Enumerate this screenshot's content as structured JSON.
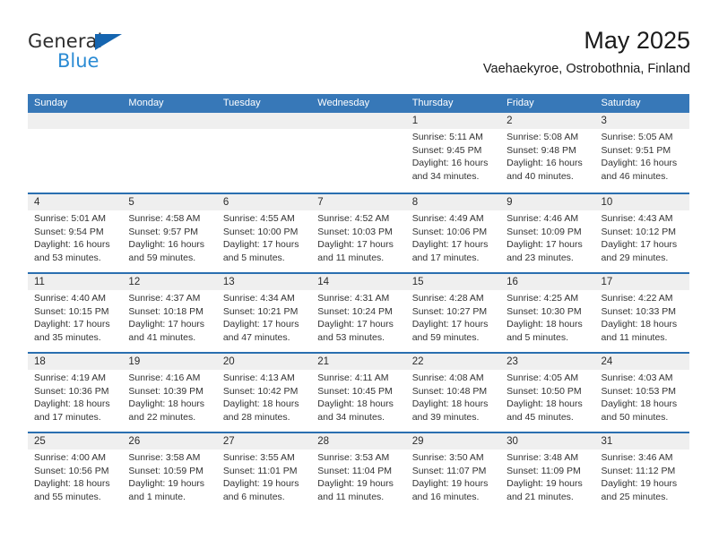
{
  "brand": {
    "name_part1": "General",
    "name_part2": "Blue",
    "triangle_icon": "blue-triangle-icon",
    "colors": {
      "dark": "#2e2e2e",
      "blue": "#2b8bd4",
      "triangle": "#1565b0"
    }
  },
  "header": {
    "title": "May 2025",
    "subtitle": "Vaehaekyroe, Ostrobothnia, Finland"
  },
  "theme": {
    "header_bg": "#3778b8",
    "header_text": "#ffffff",
    "row_divider": "#2a6fb0",
    "daynum_band": "#efefef",
    "cell_bg": "#ffffff",
    "body_text": "#333333"
  },
  "calendar": {
    "weekday_headers": [
      "Sunday",
      "Monday",
      "Tuesday",
      "Wednesday",
      "Thursday",
      "Friday",
      "Saturday"
    ],
    "weeks": [
      [
        {
          "day": "",
          "empty": true,
          "lines": []
        },
        {
          "day": "",
          "empty": true,
          "lines": []
        },
        {
          "day": "",
          "empty": true,
          "lines": []
        },
        {
          "day": "",
          "empty": true,
          "lines": []
        },
        {
          "day": "1",
          "empty": false,
          "lines": [
            "Sunrise: 5:11 AM",
            "Sunset: 9:45 PM",
            "Daylight: 16 hours",
            "and 34 minutes."
          ]
        },
        {
          "day": "2",
          "empty": false,
          "lines": [
            "Sunrise: 5:08 AM",
            "Sunset: 9:48 PM",
            "Daylight: 16 hours",
            "and 40 minutes."
          ]
        },
        {
          "day": "3",
          "empty": false,
          "lines": [
            "Sunrise: 5:05 AM",
            "Sunset: 9:51 PM",
            "Daylight: 16 hours",
            "and 46 minutes."
          ]
        }
      ],
      [
        {
          "day": "4",
          "empty": false,
          "lines": [
            "Sunrise: 5:01 AM",
            "Sunset: 9:54 PM",
            "Daylight: 16 hours",
            "and 53 minutes."
          ]
        },
        {
          "day": "5",
          "empty": false,
          "lines": [
            "Sunrise: 4:58 AM",
            "Sunset: 9:57 PM",
            "Daylight: 16 hours",
            "and 59 minutes."
          ]
        },
        {
          "day": "6",
          "empty": false,
          "lines": [
            "Sunrise: 4:55 AM",
            "Sunset: 10:00 PM",
            "Daylight: 17 hours",
            "and 5 minutes."
          ]
        },
        {
          "day": "7",
          "empty": false,
          "lines": [
            "Sunrise: 4:52 AM",
            "Sunset: 10:03 PM",
            "Daylight: 17 hours",
            "and 11 minutes."
          ]
        },
        {
          "day": "8",
          "empty": false,
          "lines": [
            "Sunrise: 4:49 AM",
            "Sunset: 10:06 PM",
            "Daylight: 17 hours",
            "and 17 minutes."
          ]
        },
        {
          "day": "9",
          "empty": false,
          "lines": [
            "Sunrise: 4:46 AM",
            "Sunset: 10:09 PM",
            "Daylight: 17 hours",
            "and 23 minutes."
          ]
        },
        {
          "day": "10",
          "empty": false,
          "lines": [
            "Sunrise: 4:43 AM",
            "Sunset: 10:12 PM",
            "Daylight: 17 hours",
            "and 29 minutes."
          ]
        }
      ],
      [
        {
          "day": "11",
          "empty": false,
          "lines": [
            "Sunrise: 4:40 AM",
            "Sunset: 10:15 PM",
            "Daylight: 17 hours",
            "and 35 minutes."
          ]
        },
        {
          "day": "12",
          "empty": false,
          "lines": [
            "Sunrise: 4:37 AM",
            "Sunset: 10:18 PM",
            "Daylight: 17 hours",
            "and 41 minutes."
          ]
        },
        {
          "day": "13",
          "empty": false,
          "lines": [
            "Sunrise: 4:34 AM",
            "Sunset: 10:21 PM",
            "Daylight: 17 hours",
            "and 47 minutes."
          ]
        },
        {
          "day": "14",
          "empty": false,
          "lines": [
            "Sunrise: 4:31 AM",
            "Sunset: 10:24 PM",
            "Daylight: 17 hours",
            "and 53 minutes."
          ]
        },
        {
          "day": "15",
          "empty": false,
          "lines": [
            "Sunrise: 4:28 AM",
            "Sunset: 10:27 PM",
            "Daylight: 17 hours",
            "and 59 minutes."
          ]
        },
        {
          "day": "16",
          "empty": false,
          "lines": [
            "Sunrise: 4:25 AM",
            "Sunset: 10:30 PM",
            "Daylight: 18 hours",
            "and 5 minutes."
          ]
        },
        {
          "day": "17",
          "empty": false,
          "lines": [
            "Sunrise: 4:22 AM",
            "Sunset: 10:33 PM",
            "Daylight: 18 hours",
            "and 11 minutes."
          ]
        }
      ],
      [
        {
          "day": "18",
          "empty": false,
          "lines": [
            "Sunrise: 4:19 AM",
            "Sunset: 10:36 PM",
            "Daylight: 18 hours",
            "and 17 minutes."
          ]
        },
        {
          "day": "19",
          "empty": false,
          "lines": [
            "Sunrise: 4:16 AM",
            "Sunset: 10:39 PM",
            "Daylight: 18 hours",
            "and 22 minutes."
          ]
        },
        {
          "day": "20",
          "empty": false,
          "lines": [
            "Sunrise: 4:13 AM",
            "Sunset: 10:42 PM",
            "Daylight: 18 hours",
            "and 28 minutes."
          ]
        },
        {
          "day": "21",
          "empty": false,
          "lines": [
            "Sunrise: 4:11 AM",
            "Sunset: 10:45 PM",
            "Daylight: 18 hours",
            "and 34 minutes."
          ]
        },
        {
          "day": "22",
          "empty": false,
          "lines": [
            "Sunrise: 4:08 AM",
            "Sunset: 10:48 PM",
            "Daylight: 18 hours",
            "and 39 minutes."
          ]
        },
        {
          "day": "23",
          "empty": false,
          "lines": [
            "Sunrise: 4:05 AM",
            "Sunset: 10:50 PM",
            "Daylight: 18 hours",
            "and 45 minutes."
          ]
        },
        {
          "day": "24",
          "empty": false,
          "lines": [
            "Sunrise: 4:03 AM",
            "Sunset: 10:53 PM",
            "Daylight: 18 hours",
            "and 50 minutes."
          ]
        }
      ],
      [
        {
          "day": "25",
          "empty": false,
          "lines": [
            "Sunrise: 4:00 AM",
            "Sunset: 10:56 PM",
            "Daylight: 18 hours",
            "and 55 minutes."
          ]
        },
        {
          "day": "26",
          "empty": false,
          "lines": [
            "Sunrise: 3:58 AM",
            "Sunset: 10:59 PM",
            "Daylight: 19 hours",
            "and 1 minute."
          ]
        },
        {
          "day": "27",
          "empty": false,
          "lines": [
            "Sunrise: 3:55 AM",
            "Sunset: 11:01 PM",
            "Daylight: 19 hours",
            "and 6 minutes."
          ]
        },
        {
          "day": "28",
          "empty": false,
          "lines": [
            "Sunrise: 3:53 AM",
            "Sunset: 11:04 PM",
            "Daylight: 19 hours",
            "and 11 minutes."
          ]
        },
        {
          "day": "29",
          "empty": false,
          "lines": [
            "Sunrise: 3:50 AM",
            "Sunset: 11:07 PM",
            "Daylight: 19 hours",
            "and 16 minutes."
          ]
        },
        {
          "day": "30",
          "empty": false,
          "lines": [
            "Sunrise: 3:48 AM",
            "Sunset: 11:09 PM",
            "Daylight: 19 hours",
            "and 21 minutes."
          ]
        },
        {
          "day": "31",
          "empty": false,
          "lines": [
            "Sunrise: 3:46 AM",
            "Sunset: 11:12 PM",
            "Daylight: 19 hours",
            "and 25 minutes."
          ]
        }
      ]
    ]
  }
}
